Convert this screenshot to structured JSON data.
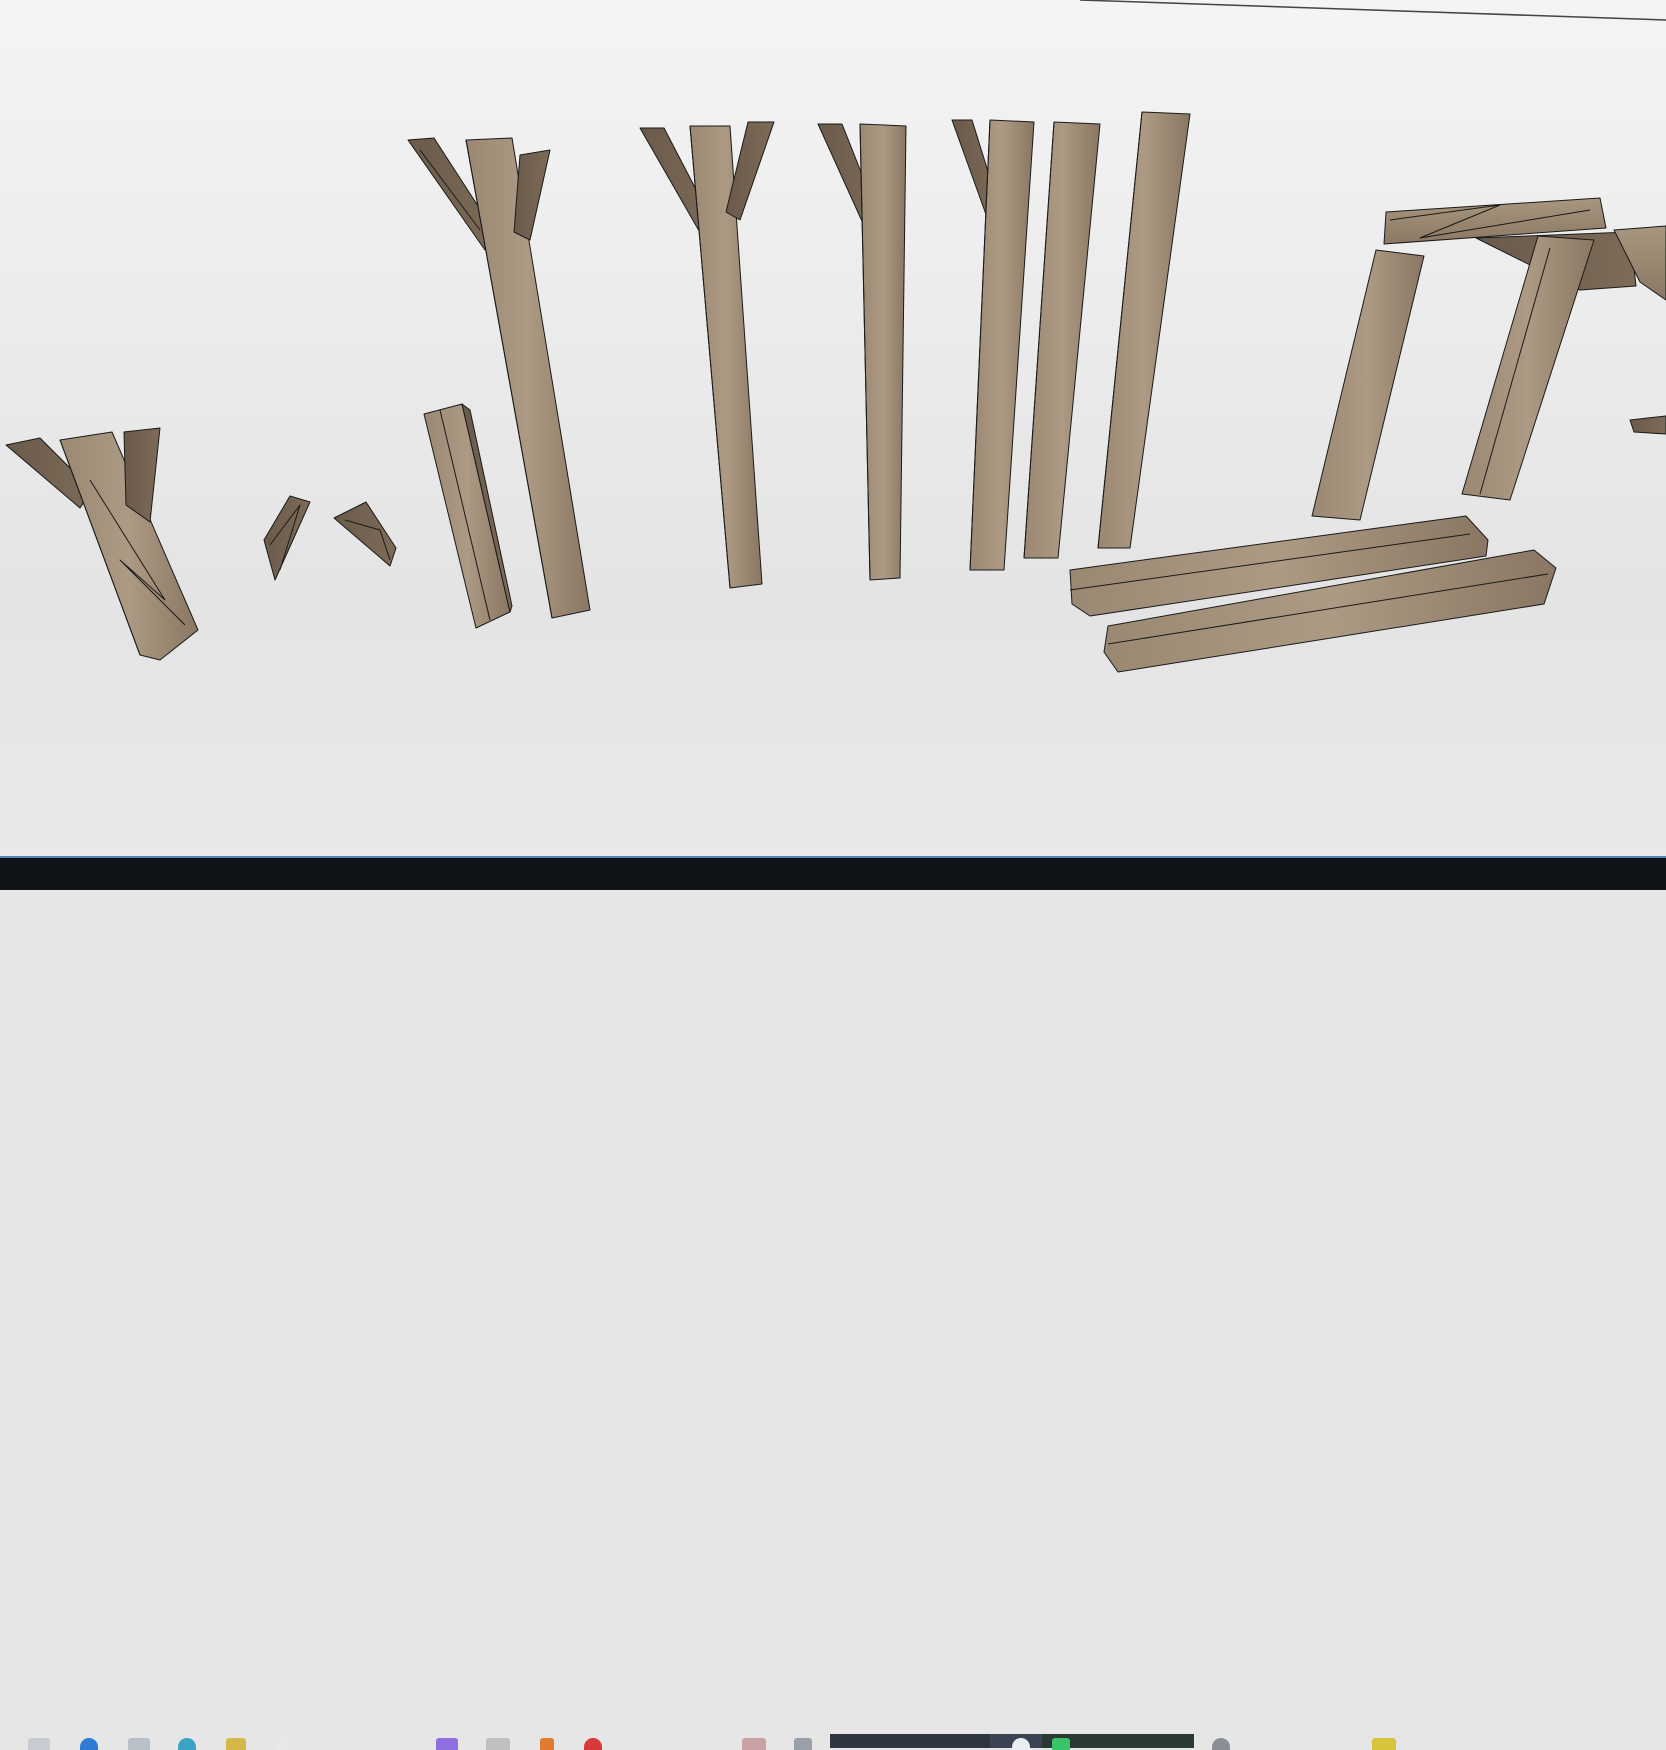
{
  "app": {
    "name": "3D Viewport"
  },
  "viewport": {
    "background": "#e8e8e8",
    "wireframe_color": "#1a1a1a",
    "wood_light": "#a2907a",
    "wood_mid": "#8b7762",
    "wood_dark": "#5c4c3e",
    "objects": [
      "forked-beam-short",
      "beam-fragment-1",
      "beam-fragment-2",
      "short-post",
      "forked-post-tall",
      "forked-post-2",
      "forked-post-3",
      "forked-post-4",
      "straight-post-1",
      "straight-post-2",
      "doorframe-assembly",
      "horizontal-beam-1",
      "horizontal-beam-2"
    ]
  },
  "taskbar": {
    "background": "#0f1318",
    "icons": [
      "start-icon",
      "edge-icon",
      "mail-icon",
      "chrome-icon",
      "explorer-icon",
      "file-icon",
      "app-icon-purple",
      "app-icon-striped",
      "app-icon-orange",
      "app-icon-red",
      "app-icon-image",
      "app-icon-gray",
      "app-icon-active-1",
      "app-icon-active-2",
      "app-icon-active-3",
      "app-icon-gray-2",
      "app-icon-yellow"
    ]
  }
}
